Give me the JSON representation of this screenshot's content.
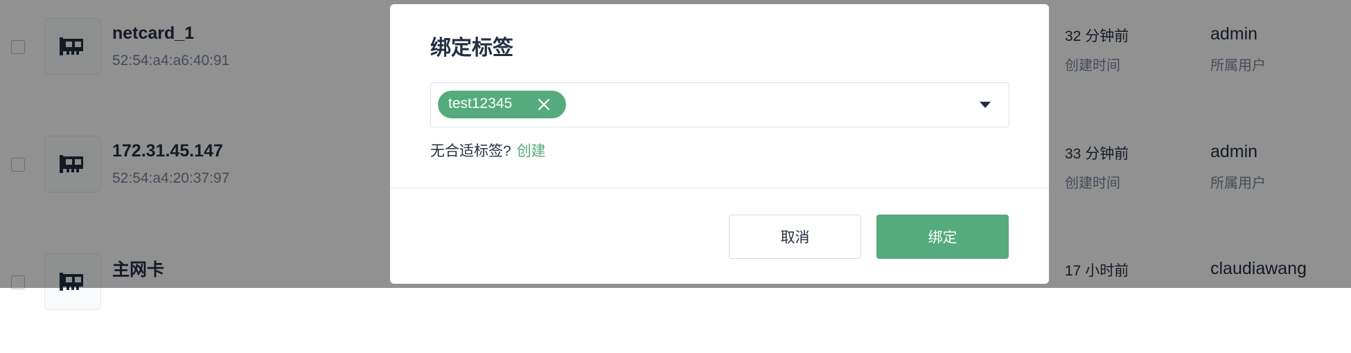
{
  "rows": [
    {
      "name": "netcard_1",
      "mac": "52:54:a4:a6:40:91",
      "time": "32 分钟前",
      "time_label": "创建时间",
      "user": "admin",
      "user_label": "所属用户"
    },
    {
      "name": "172.31.45.147",
      "mac": "52:54:a4:20:37:97",
      "time": "33 分钟前",
      "time_label": "创建时间",
      "user": "admin",
      "user_label": "所属用户"
    },
    {
      "name": "主网卡",
      "mac": "",
      "time": "17 小时前",
      "time_label": "",
      "user": "claudiawang",
      "user_label": ""
    }
  ],
  "icons": {
    "row_icon": "network-card-icon",
    "tag_remove": "close-icon",
    "dropdown": "caret-down-icon"
  },
  "modal": {
    "title": "绑定标签",
    "selected_tags": [
      "test12345"
    ],
    "hint_text": "无合适标签?",
    "hint_link": "创建",
    "cancel_label": "取消",
    "confirm_label": "绑定"
  },
  "colors": {
    "accent": "#55ab7b",
    "overlay": "rgba(0,0,0,0.43)",
    "text": "#242e42",
    "muted": "#79879c"
  }
}
